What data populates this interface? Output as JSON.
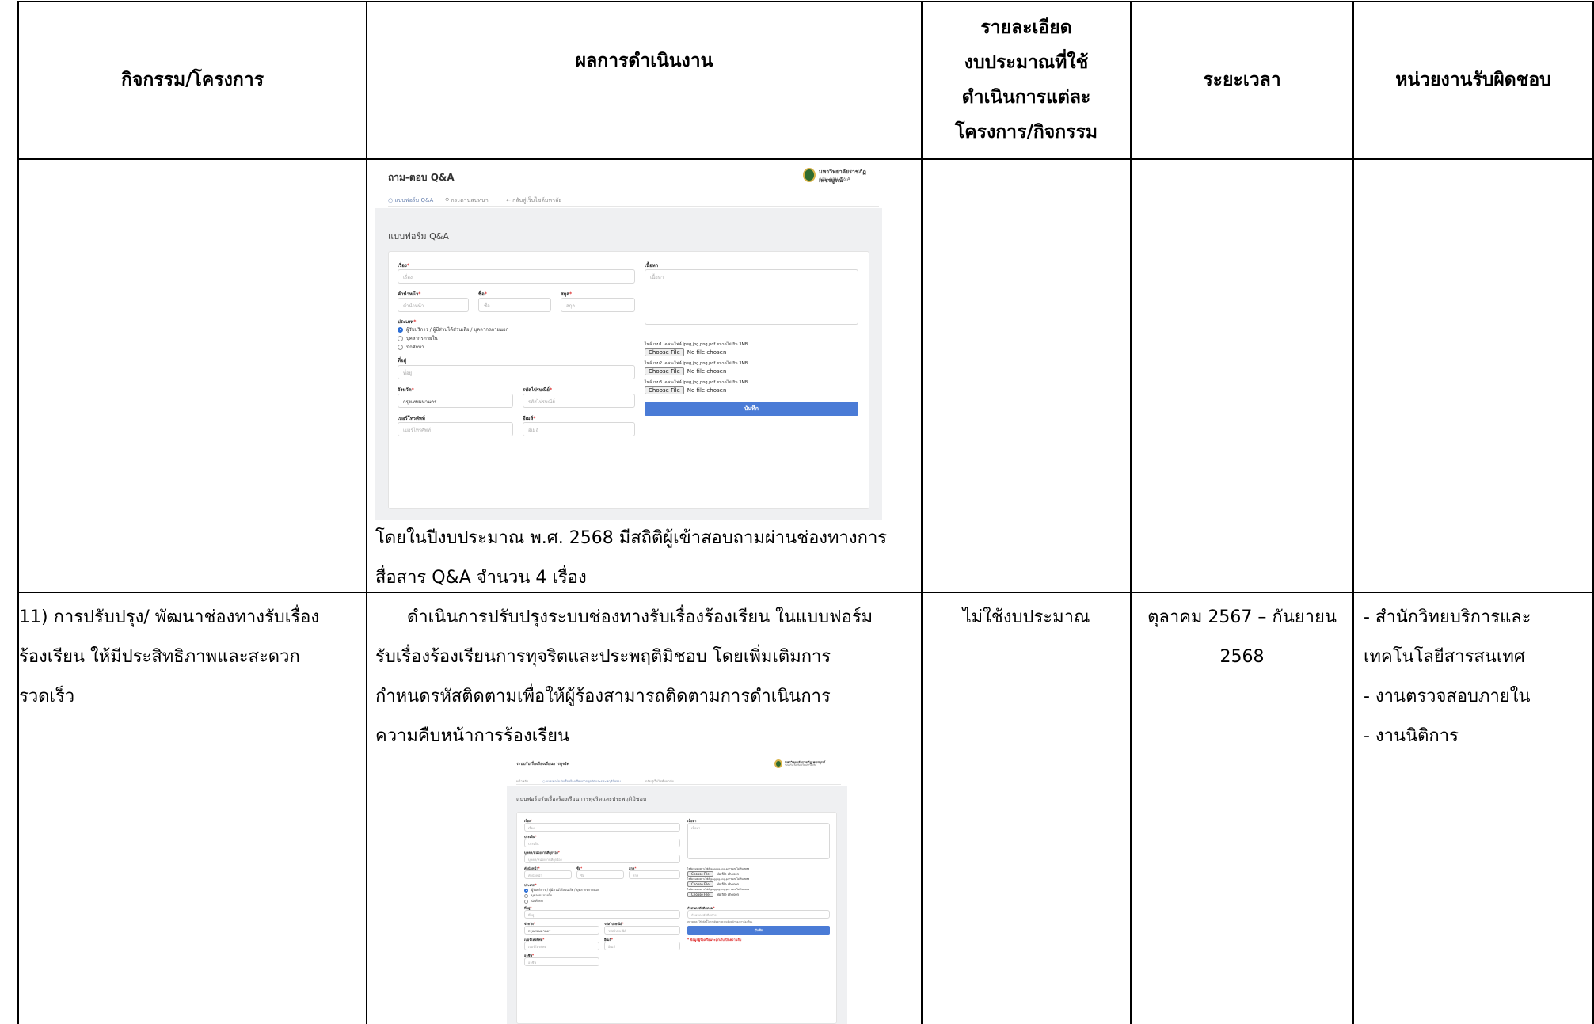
{
  "table": {
    "headers": {
      "activity": "กิจกรรม/โครงการ",
      "results": "ผลการดำเนินงาน",
      "budget": [
        "รายละเอียด",
        "งบประมาณที่ใช้",
        "ดำเนินการแต่ละ",
        "โครงการ/กิจกรรม"
      ],
      "period": "ระยะเวลา",
      "unit": "หน่วยงานรับผิดชอบ"
    },
    "row1": {
      "stats_lines": [
        "โดยในปีงบประมาณ พ.ศ. 2568 มีสถิติผู้เข้าสอบถามผ่านช่องทางการ",
        "สื่อสาร Q&A จำนวน 4 เรื่อง"
      ]
    },
    "row2": {
      "activity_lines": [
        "11) การปรับปรุง/ พัฒนาช่องทางรับเรื่อง",
        "ร้องเรียน ให้มีประสิทธิภาพและสะดวก",
        "รวดเร็ว"
      ],
      "result_lines": [
        "ดำเนินการปรับปรุงระบบช่องทางรับเรื่องร้องเรียน ในแบบฟอร์ม",
        "รับเรื่องร้องเรียนการทุจริตและประพฤติมิชอบ โดยเพิ่มเติมการ",
        "กำหนดรหัสติดตามเพื่อให้ผู้ร้องสามารถติดตามการดำเนินการ",
        "ความคืบหน้าการร้องเรียน"
      ],
      "budget": "ไม่ใช้งบประมาณ",
      "period_lines": [
        "ตุลาคม 2567 – กันยายน",
        "2568"
      ],
      "unit_lines": [
        "- สำนักวิทยบริการและ",
        "เทคโนโลยีสารสนเทศ",
        "- งานตรวจสอบภายใน",
        "- งานนิติการ"
      ]
    }
  },
  "qa_form": {
    "app_title": "ถาม-ตอบ Q&A",
    "org_name": "มหาวิทยาลัยราชภัฏเพชรบูรณ์",
    "org_sub": "ถาม-ตอบ Q&A",
    "tabs": [
      "แบบฟอร์ม Q&A",
      "กระดานสนทนา",
      "← กลับสู่เว็บไซต์มหาลัย"
    ],
    "form_title": "แบบฟอร์ม Q&A",
    "subject_label": "เรื่อง",
    "subject_ph": "เรื่อง",
    "content_label": "เนื้อหา",
    "content_ph": "เนื้อหา",
    "prefix_label": "คำนำหน้า",
    "prefix_ph": "คำนำหน้า",
    "name_label": "ชื่อ",
    "name_ph": "ชื่อ",
    "surname_label": "สกุล",
    "surname_ph": "สกุล",
    "type_label": "ประเภท",
    "type_options": [
      "ผู้รับบริการ / ผู้มีส่วนได้ส่วนเสีย / บุคลากรภายนอก",
      "บุคลากรภายใน",
      "นักศึกษา"
    ],
    "address_label": "ที่อยู่",
    "address_ph": "ที่อยู่",
    "province_label": "จังหวัด",
    "province_value": "กรุงเทพมหานคร",
    "postal_label": "รหัสไปรษณีย์",
    "postal_ph": "รหัสไปรษณีย์",
    "phone_label": "เบอร์โทรศัพท์",
    "phone_ph": "เบอร์โทรศัพท์",
    "email_label": "อีเมล์",
    "email_ph": "อีเมล์",
    "attach1": "ไฟล์แนบ1 เฉพาะไฟล์ jpeg,jpg,png,pdf ขนาดไม่เกิน 3MB",
    "attach2": "ไฟล์แนบ2 เฉพาะไฟล์ jpeg,jpg,png,pdf ขนาดไม่เกิน 3MB",
    "attach3": "ไฟล์แนบ3 เฉพาะไฟล์ jpeg,jpg,png,pdf ขนาดไม่เกิน 3MB",
    "choose_file": "Choose File",
    "no_file": "No file chosen",
    "save": "บันทึก"
  },
  "complaint_form": {
    "app_title": "ระบบรับเรื่องร้องเรียนการทุจริต",
    "org_name": "มหาวิทยาลัยราชภัฏเพชรบูรณ์",
    "org_sub": "ระบบรับเรื่องร้องเรียนการทุจริต",
    "tabs": [
      "หน้าหลัก",
      "แบบฟอร์มรับเรื่องร้องเรียนการทุจริตและประพฤติมิชอบ",
      "กลับสู่เว็บไซต์มหาลัย"
    ],
    "form_title": "แบบฟอร์มรับเรื่องร้องเรียนการทุจริตและประพฤติมิชอบ",
    "subject_label": "เรื่อง",
    "subject_ph": "เรื่อง",
    "topic_label": "ประเด็น",
    "topic_ph": "ประเด็น",
    "accused_label": "บุคคล/หน่วยงานที่ถูกร้อง",
    "accused_ph": "บุคคล/หน่วยงานที่ถูกร้อง",
    "prefix_label": "คำนำหน้า",
    "prefix_ph": "คำนำหน้า",
    "name_label": "ชื่อ",
    "name_ph": "ชื่อ",
    "surname_label": "สกุล",
    "surname_ph": "สกุล",
    "type_label": "ประเภท",
    "type_options": [
      "ผู้รับบริการ / ผู้มีส่วนได้ส่วนเสีย / บุคลากรภายนอก",
      "บุคลากรภายใน",
      "นักศึกษา"
    ],
    "address_label": "ที่อยู่",
    "address_ph": "ที่อยู่",
    "province_label": "จังหวัด",
    "province_value": "กรุงเทพมหานคร",
    "postal_label": "รหัสไปรษณีย์",
    "postal_ph": "รหัสไปรษณีย์",
    "phone_label": "เบอร์โทรศัพท์",
    "phone_ph": "เบอร์โทรศัพท์",
    "email_label": "อีเมล์",
    "email_ph": "อีเมล์",
    "extra_label": "อาชีพ",
    "extra_ph": "อาชีพ",
    "content_label": "เนื้อหา",
    "content_ph": "เนื้อหา",
    "attach1": "ไฟล์แนบ1 เฉพาะไฟล์ jpeg,jpg,png,pdf ขนาดไม่เกิน 3MB",
    "attach2": "ไฟล์แนบ2 เฉพาะไฟล์ jpeg,jpg,png,pdf ขนาดไม่เกิน 3MB",
    "attach3": "ไฟล์แนบ3 เฉพาะไฟล์ jpeg,jpg,png,pdf ขนาดไม่เกิน 3MB",
    "choose_file": "Choose File",
    "no_file": "No file chosen",
    "tracking_label": "กำหนดรหัสติดตาม",
    "tracking_ph": "กำหนดรหัสติดตาม",
    "tracking_note": "หมายเหตุ: ใช้รหัสนี้ในการติดตามความคืบหน้าของการร้องเรียน",
    "save": "บันทึก",
    "warning": "* ข้อมูลผู้ร้องเรียนจะถูกเก็บเป็นความลับ"
  }
}
